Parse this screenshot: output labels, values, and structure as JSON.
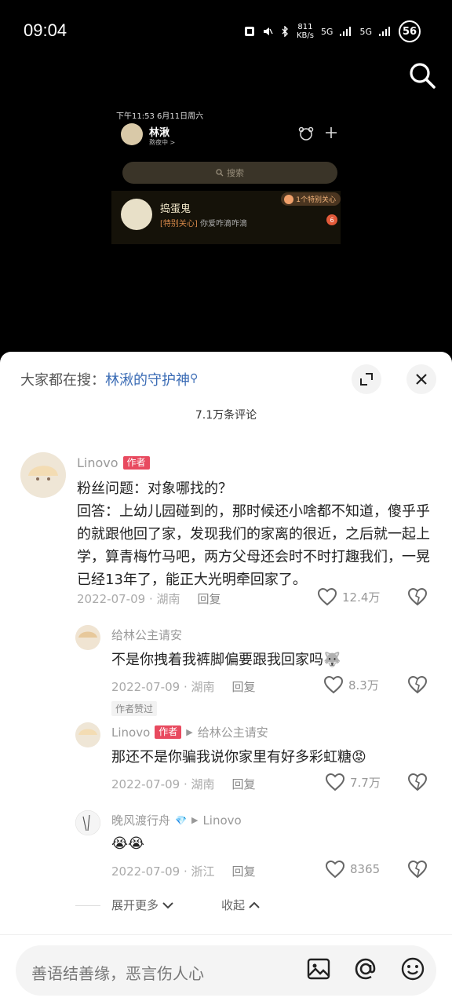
{
  "status_bar": {
    "time": "09:04",
    "net_speed_value": "811",
    "net_speed_unit": "KB/s",
    "signal1": "5G",
    "signal2": "5G",
    "battery": "56"
  },
  "preview": {
    "date": "下午11:53  6月11日周六",
    "name": "林湫",
    "subtitle": "熬夜中 >",
    "search_placeholder": "搜索",
    "chat_name": "捣蛋鬼",
    "chat_tag": "[特别关心]",
    "chat_msg": " 你爱咋滴咋滴",
    "care_badge": "1个特别关心",
    "unread": "6"
  },
  "sheet": {
    "hot_prefix": "大家都在搜：",
    "hot_keyword": "林湫的守护神",
    "comment_count": "7.1万条评论"
  },
  "comments": [
    {
      "user": "Linovo",
      "tag": "作者",
      "text": "粉丝问题：对象哪找的？\n回答：上幼儿园碰到的，那时候还小啥都不知道，傻乎乎的就跟他回了家，发现我们的家离的很近，之后就一起上学，算青梅竹马吧，两方父母还会时不时打趣我们，一晃已经13年了，能正大光明牵回家了。",
      "date": "2022-07-09 · 湖南",
      "reply": "回复",
      "likes": "12.4万"
    },
    {
      "user": "给林公主请安",
      "text": "不是你拽着我裤脚偏要跟我回家吗",
      "date": "2022-07-09 · 湖南",
      "reply": "回复",
      "likes": "8.3万",
      "liked_by_author": "作者赞过"
    },
    {
      "user": "Linovo",
      "tag": "作者",
      "reply_to": "给林公主请安",
      "text": "那还不是你骗我说你家里有好多彩虹糖",
      "date": "2022-07-09 · 湖南",
      "reply": "回复",
      "likes": "7.7万"
    },
    {
      "user": "晚风渡行舟",
      "reply_to": "Linovo",
      "text": "😭😭",
      "date": "2022-07-09 · 浙江",
      "reply": "回复",
      "likes": "8365"
    }
  ],
  "expand_more": "展开更多",
  "collapse": "收起",
  "input": {
    "placeholder": "善语结善缘，恶言伤人心"
  },
  "colors": {
    "accent": "#3b6cb5",
    "author_tag": "#e84a5f",
    "sheet_bg": "#ffffff"
  }
}
